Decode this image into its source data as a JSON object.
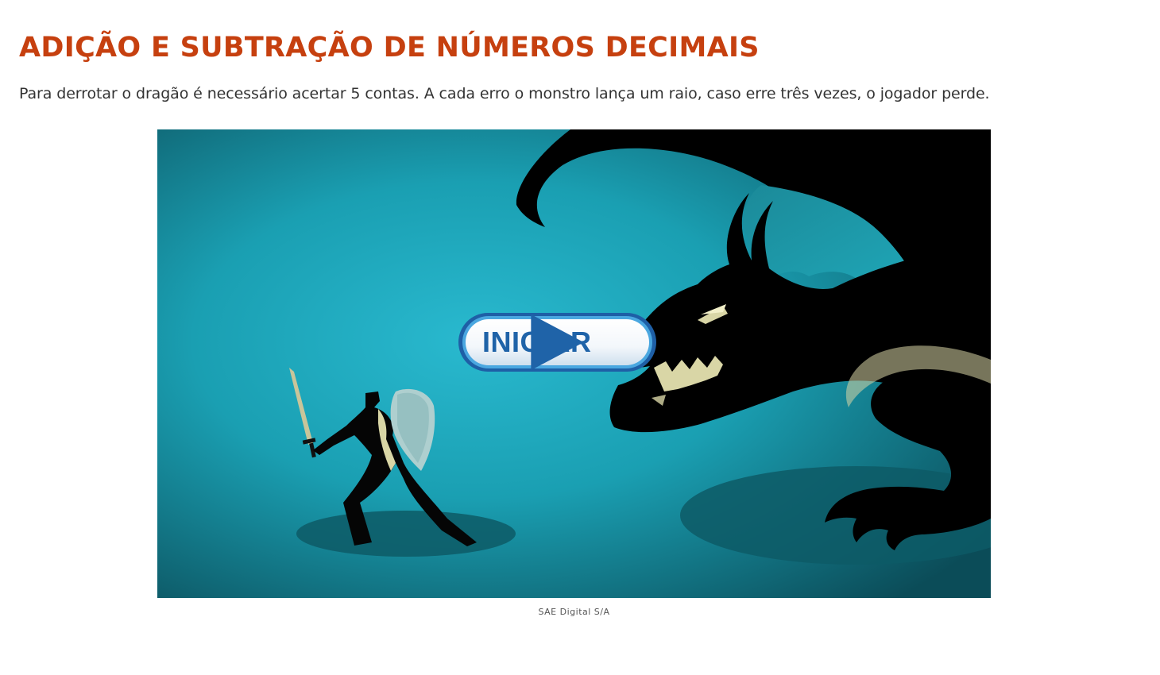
{
  "page": {
    "title": "ADIÇÃO E SUBTRAÇÃO DE NÚMEROS DECIMAIS",
    "description": "Para derrotar o dragão é necessário acertar 5 contas. A cada erro o monstro lança um raio, caso erre três vezes, o jogador perde."
  },
  "game": {
    "start_button_label": "INICIAR",
    "start_icon": "play-icon",
    "caption": "SAE Digital S/A"
  },
  "colors": {
    "title": "#c6400f",
    "background_center": "#28b7cc",
    "background_edge": "#0b4a55",
    "button_text": "#1f63a8",
    "silhouette": "#000000",
    "accent": "#d9d6a6"
  }
}
